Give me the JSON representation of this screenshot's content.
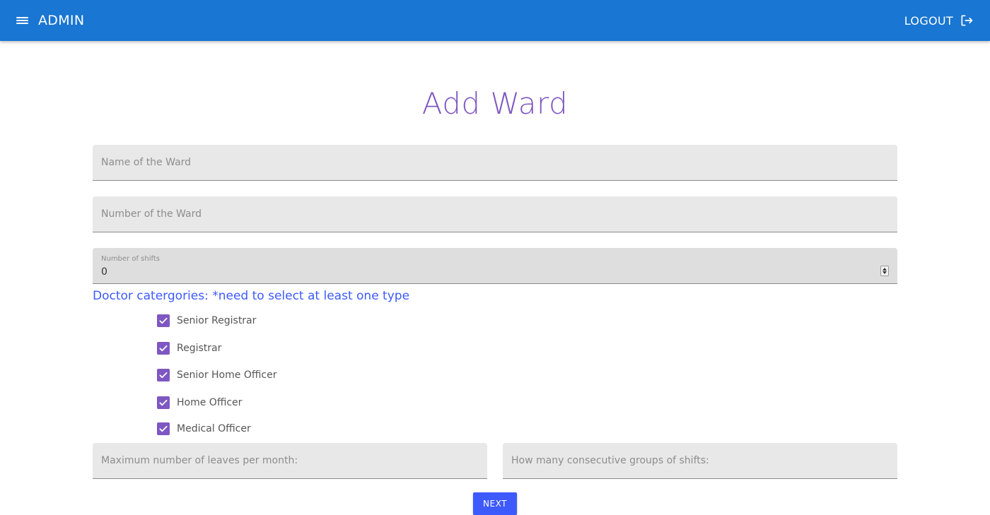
{
  "appbar": {
    "title": "ADMIN",
    "menu_icon": "menu-icon",
    "logout_label": "LOGOUT",
    "logout_icon": "logout-icon",
    "color": "#1976d2"
  },
  "page": {
    "title": "Add Ward"
  },
  "form": {
    "ward_name": {
      "placeholder": "Name of the Ward",
      "value": ""
    },
    "ward_number": {
      "placeholder": "Number of the Ward",
      "value": ""
    },
    "shifts": {
      "label": "Number of shifts",
      "value": "0"
    },
    "categories_heading": "Doctor catergories: *need to select at least one type",
    "categories": [
      {
        "label": "Senior Registrar",
        "checked": true
      },
      {
        "label": "Registrar",
        "checked": true
      },
      {
        "label": "Senior Home Officer",
        "checked": true
      },
      {
        "label": "Home Officer",
        "checked": true
      },
      {
        "label": "Medical Officer",
        "checked": true
      }
    ],
    "max_leaves": {
      "placeholder": "Maximum number of leaves per month:",
      "value": ""
    },
    "consecutive_groups": {
      "placeholder": "How many consecutive groups of shifts:",
      "value": ""
    },
    "next_label": "NEXT"
  },
  "colors": {
    "accent": "#7e57c2",
    "primary": "#3d5afe",
    "field_bg": "#e8e8e8"
  }
}
